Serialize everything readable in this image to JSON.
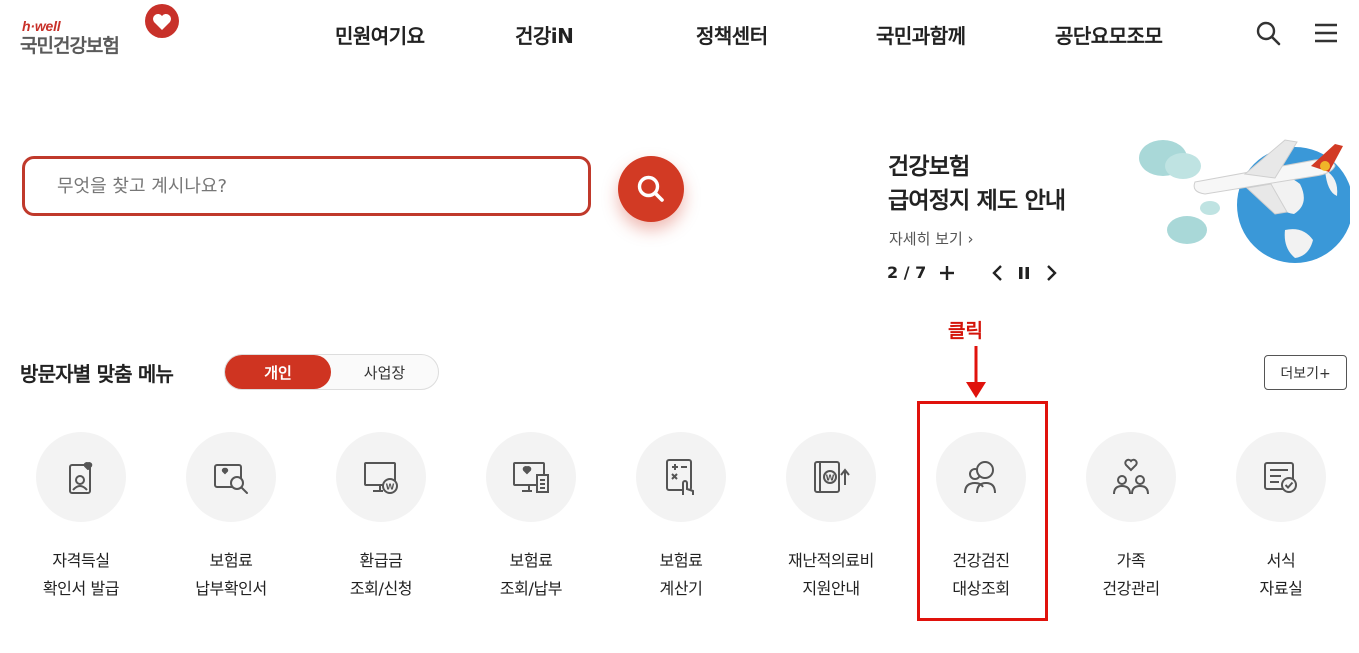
{
  "header": {
    "logo_small": "h·well",
    "logo_main": "국민건강보험",
    "nav": [
      "민원여기요",
      "건강iN",
      "정책센터",
      "국민과함께",
      "공단요모조모"
    ],
    "search_icon": "search-icon",
    "menu_icon": "hamburger-menu-icon"
  },
  "search": {
    "placeholder": "무엇을 찾고 계시나요?",
    "button_icon": "search-icon"
  },
  "banner": {
    "title_line1": "건강보험",
    "title_line2": "급여정지 제도 안내",
    "link": "자세히 보기 ›",
    "counter": "2 / 7"
  },
  "section": {
    "title": "방문자별 맞춤 메뉴",
    "toggle_on": "개인",
    "toggle_off": "사업장",
    "more": "더보기+"
  },
  "annotation": {
    "label": "클릭",
    "color": "#e0120c"
  },
  "menu": [
    {
      "line1": "자격득실",
      "line2": "확인서 발급",
      "icon": "id-card-heart-icon"
    },
    {
      "line1": "보험료",
      "line2": "납부확인서",
      "icon": "document-search-icon"
    },
    {
      "line1": "환급금",
      "line2": "조회/신청",
      "icon": "monitor-won-icon"
    },
    {
      "line1": "보험료",
      "line2": "조회/납부",
      "icon": "monitor-receipt-icon"
    },
    {
      "line1": "보험료",
      "line2": "계산기",
      "icon": "calculator-hand-icon"
    },
    {
      "line1": "재난적의료비",
      "line2": "지원안내",
      "icon": "book-won-up-icon"
    },
    {
      "line1": "건강검진",
      "line2": "대상조회",
      "icon": "people-search-icon"
    },
    {
      "line1": "가족",
      "line2": "건강관리",
      "icon": "family-heart-icon"
    },
    {
      "line1": "서식",
      "line2": "자료실",
      "icon": "form-check-icon"
    }
  ],
  "colors": {
    "brand": "#d23a24",
    "accent_dark": "#c0392b",
    "icon_stroke": "#555555"
  }
}
